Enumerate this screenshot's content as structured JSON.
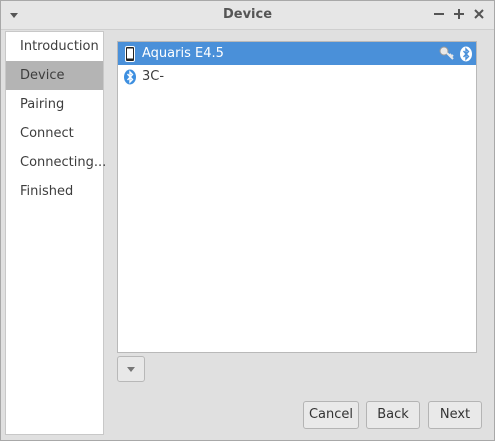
{
  "window": {
    "title": "Device"
  },
  "sidebar": {
    "items": [
      {
        "label": "Introduction",
        "active": false
      },
      {
        "label": "Device",
        "active": true
      },
      {
        "label": "Pairing",
        "active": false
      },
      {
        "label": "Connect",
        "active": false
      },
      {
        "label": "Connecting...",
        "active": false
      },
      {
        "label": "Finished",
        "active": false
      }
    ]
  },
  "devices": [
    {
      "name": "Aquaris E4.5",
      "icon": "phone-icon",
      "selected": true,
      "paired_key": true,
      "bluetooth": true
    },
    {
      "name": "3C-",
      "icon": "bluetooth-icon",
      "selected": false,
      "paired_key": false,
      "bluetooth": false
    }
  ],
  "buttons": {
    "cancel": "Cancel",
    "back": "Back",
    "next": "Next"
  },
  "colors": {
    "selection": "#4a90d9",
    "sidebar_active": "#b4b4b4"
  }
}
